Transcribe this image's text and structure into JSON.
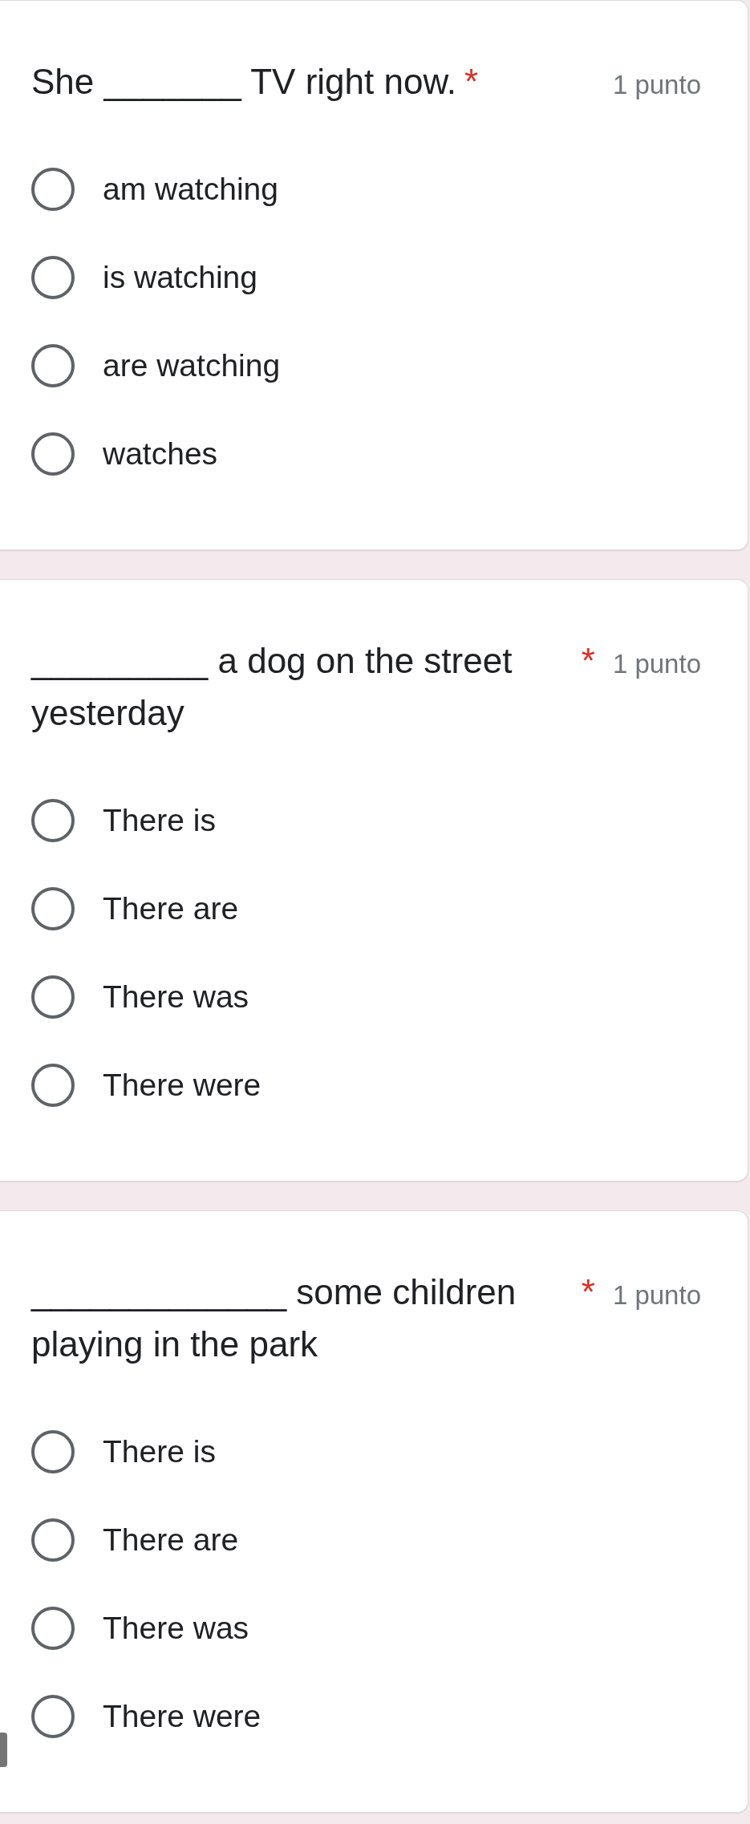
{
  "questions": [
    {
      "title": "She _______ TV right now.",
      "required_mark": "*",
      "points": "1 punto",
      "options": [
        {
          "label": "am watching",
          "selected": false
        },
        {
          "label": "is watching",
          "selected": false
        },
        {
          "label": "are watching",
          "selected": false
        },
        {
          "label": "watches",
          "selected": false
        }
      ]
    },
    {
      "title": "_________ a dog on the street yesterday",
      "required_mark": "*",
      "points": "1 punto",
      "options": [
        {
          "label": "There is",
          "selected": false
        },
        {
          "label": "There are",
          "selected": false
        },
        {
          "label": "There was",
          "selected": false
        },
        {
          "label": "There were",
          "selected": false
        }
      ]
    },
    {
      "title": "_____________ some children playing in the park",
      "required_mark": "*",
      "points": "1 punto",
      "options": [
        {
          "label": "There is",
          "selected": false
        },
        {
          "label": "There are",
          "selected": false
        },
        {
          "label": "There was",
          "selected": false
        },
        {
          "label": "There were",
          "selected": false
        }
      ]
    }
  ]
}
